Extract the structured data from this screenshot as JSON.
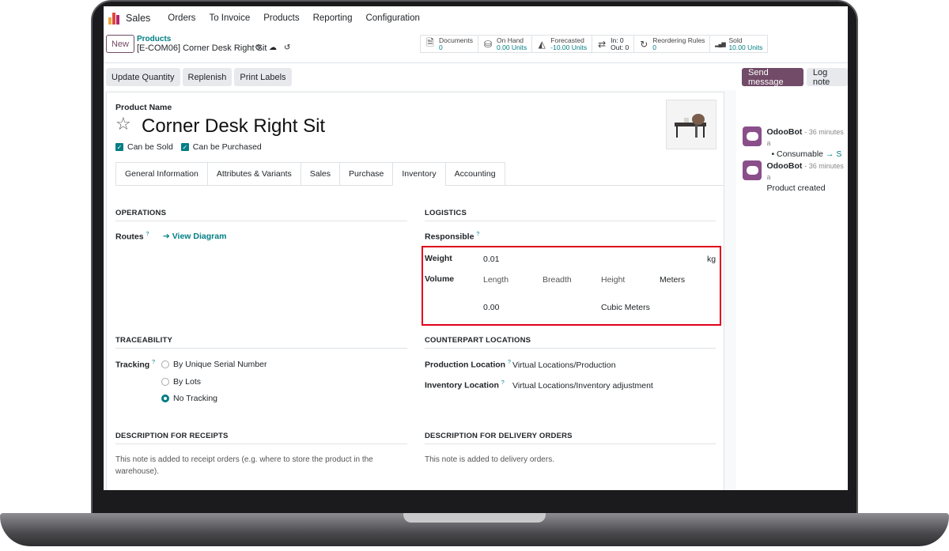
{
  "nav": {
    "app_name": "Sales",
    "menu": [
      "Orders",
      "To Invoice",
      "Products",
      "Reporting",
      "Configuration"
    ]
  },
  "control": {
    "new_label": "New",
    "breadcrumb_parent": "Products",
    "breadcrumb_current": "[E-COM06] Corner Desk Right Sit"
  },
  "smart_buttons": [
    {
      "icon": "document-icon",
      "glyph": "🗎",
      "line1": "Documents",
      "line2": "0"
    },
    {
      "icon": "cubes-icon",
      "glyph": "⛁",
      "line1": "On Hand",
      "line2": "0.00 Units"
    },
    {
      "icon": "area-chart-icon",
      "glyph": "◭",
      "line1": "Forecasted",
      "line2": "-10.00 Units"
    },
    {
      "icon": "exchange-icon",
      "glyph": "⇄",
      "line1": "In: 0",
      "line2": "Out: 0"
    },
    {
      "icon": "refresh-icon",
      "glyph": "↻",
      "line1": "Reordering Rules",
      "line2": "0"
    },
    {
      "icon": "signal-icon",
      "glyph": "▂▄▆",
      "line1": "Sold",
      "line2": "10.00 Units"
    }
  ],
  "actions": [
    "Update Quantity",
    "Replenish",
    "Print Labels"
  ],
  "chatter_buttons": {
    "send": "Send message",
    "log": "Log note"
  },
  "product": {
    "name_label": "Product Name",
    "name": "Corner Desk Right Sit",
    "can_be_sold": "Can be Sold",
    "can_be_purchased": "Can be Purchased"
  },
  "tabs": [
    "General Information",
    "Attributes & Variants",
    "Sales",
    "Purchase",
    "Inventory",
    "Accounting"
  ],
  "active_tab": "Inventory",
  "operations": {
    "title": "OPERATIONS",
    "routes_label": "Routes",
    "routes_help": "?",
    "view_diagram": "View Diagram"
  },
  "logistics": {
    "title": "LOGISTICS",
    "responsible_label": "Responsible",
    "responsible_help": "?",
    "weight_label": "Weight",
    "weight_value": "0.01",
    "weight_unit": "kg",
    "volume_label": "Volume",
    "length": "Length",
    "breadth": "Breadth",
    "height": "Height",
    "dim_unit": "Meters",
    "volume_value": "0.00",
    "volume_unit": "Cubic Meters"
  },
  "traceability": {
    "title": "TRACEABILITY",
    "tracking_label": "Tracking",
    "tracking_help": "?",
    "options": [
      "By Unique Serial Number",
      "By Lots",
      "No Tracking"
    ],
    "selected": "No Tracking"
  },
  "counterpart": {
    "title": "COUNTERPART LOCATIONS",
    "production_label": "Production Location",
    "production_help": "?",
    "production_value": "Virtual Locations/Production",
    "inventory_label": "Inventory Location",
    "inventory_help": "?",
    "inventory_value": "Virtual Locations/Inventory adjustment"
  },
  "receipts": {
    "title": "DESCRIPTION FOR RECEIPTS",
    "placeholder": "This note is added to receipt orders (e.g. where to store the product in the warehouse)."
  },
  "delivery": {
    "title": "DESCRIPTION FOR DELIVERY ORDERS",
    "placeholder": "This note is added to delivery orders."
  },
  "chatter": [
    {
      "author": "OdooBot",
      "time": "- 36 minutes a",
      "text": "Consumable",
      "arrow": "→ S"
    },
    {
      "author": "OdooBot",
      "time": "- 36 minutes a",
      "text": "Product created"
    }
  ],
  "colors": {
    "brand": "#714B67",
    "accent": "#017e84",
    "highlight_box": "#e0001b"
  }
}
